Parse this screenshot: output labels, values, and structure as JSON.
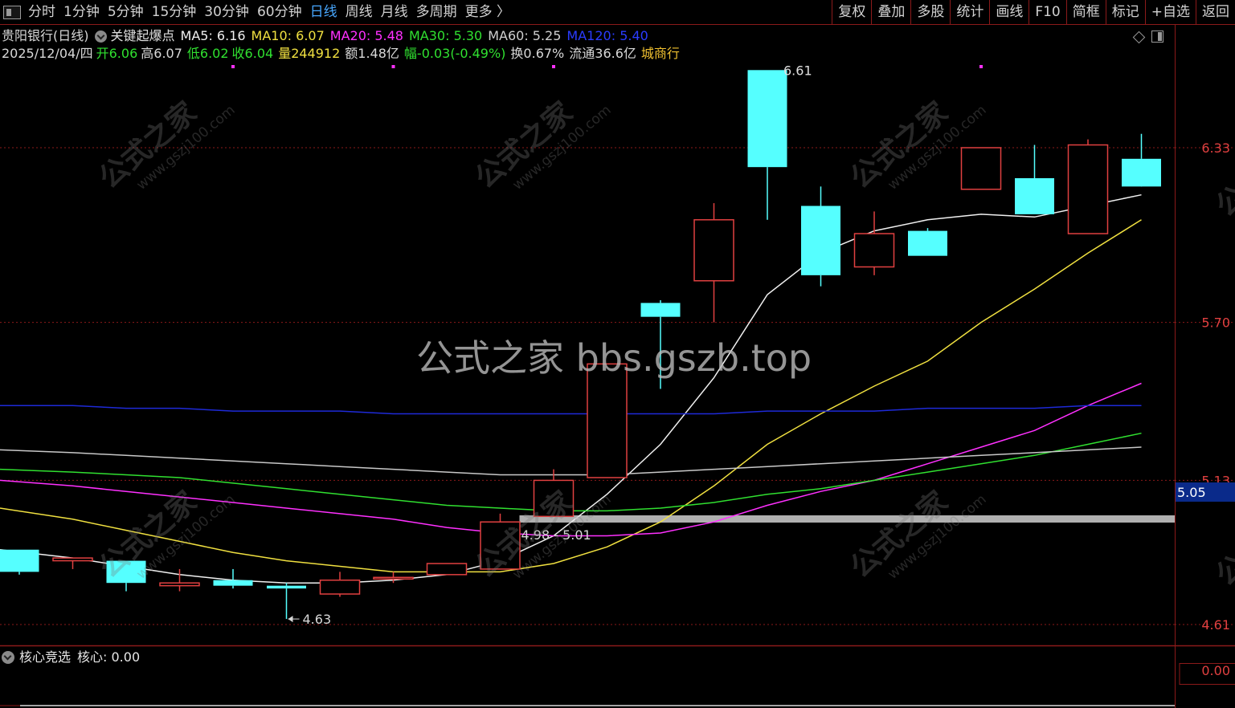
{
  "toolbar": {
    "period_tabs": [
      {
        "label": "分时",
        "active": false
      },
      {
        "label": "1分钟",
        "active": false
      },
      {
        "label": "5分钟",
        "active": false
      },
      {
        "label": "15分钟",
        "active": false
      },
      {
        "label": "30分钟",
        "active": false
      },
      {
        "label": "60分钟",
        "active": false
      },
      {
        "label": "日线",
        "active": true
      },
      {
        "label": "周线",
        "active": false
      },
      {
        "label": "月线",
        "active": false
      },
      {
        "label": "多周期",
        "active": false
      },
      {
        "label": "更多 〉",
        "active": false
      }
    ],
    "tools": [
      "复权",
      "叠加",
      "多股",
      "统计",
      "画线",
      "F10",
      "简框",
      "标记",
      "+自选",
      "返回"
    ]
  },
  "info": {
    "stock_name": "贵阳银行(日线)",
    "formula_name": "关键起爆点",
    "ma5": "MA5: 6.16",
    "ma10": "MA10: 6.07",
    "ma20": "MA20: 5.48",
    "ma30": "MA30: 5.30",
    "ma60": "MA60: 5.25",
    "ma120": "MA120: 5.40",
    "date": "2025/12/04/四",
    "open": "开6.06",
    "high": "高6.07",
    "low": "低6.02",
    "close": "收6.04",
    "volume": "量244912",
    "amount": "额1.48亿",
    "change": "幅-0.03(-0.49%)",
    "turnover": "换0.67%",
    "float_cap": "流通36.6亿",
    "industry": "城商行"
  },
  "indicator": {
    "name": "核心竞选",
    "value": "核心: 0.00",
    "axis_label": "0.00"
  },
  "watermark": {
    "center": "公式之家 bbs.gszb.top",
    "tile_cn": "公式之家",
    "tile_url": "www.gszj100.com"
  },
  "colors": {
    "up": "#e04040",
    "down": "#55ffff",
    "ma5": "#f0f0f0",
    "ma10": "#f0e040",
    "ma20": "#ff30ff",
    "ma30": "#30e030",
    "ma60": "#c8c8c8",
    "ma120": "#1e2ad8",
    "grid": "#8b1a1a",
    "zone": "#b0b0b0"
  },
  "chart_data": {
    "type": "candlestick",
    "y_ticks": [
      "6.33",
      "5.70",
      "5.13",
      "4.61"
    ],
    "y_range": [
      4.5,
      6.8
    ],
    "price_tag": "5.05",
    "zone_label": "4.98 - 5.01",
    "zone_range": [
      4.98,
      5.01
    ],
    "low_label": "4.63",
    "high_label": "6.61",
    "candles": [
      {
        "o": 4.88,
        "h": 4.88,
        "l": 4.79,
        "c": 4.8
      },
      {
        "o": 4.84,
        "h": 4.85,
        "l": 4.81,
        "c": 4.85
      },
      {
        "o": 4.84,
        "h": 4.84,
        "l": 4.73,
        "c": 4.76
      },
      {
        "o": 4.75,
        "h": 4.81,
        "l": 4.73,
        "c": 4.76
      },
      {
        "o": 4.77,
        "h": 4.81,
        "l": 4.74,
        "c": 4.75
      },
      {
        "o": 4.75,
        "h": 4.76,
        "l": 4.63,
        "c": 4.74
      },
      {
        "o": 4.72,
        "h": 4.8,
        "l": 4.71,
        "c": 4.77
      },
      {
        "o": 4.78,
        "h": 4.8,
        "l": 4.76,
        "c": 4.78
      },
      {
        "o": 4.79,
        "h": 4.82,
        "l": 4.79,
        "c": 4.83
      },
      {
        "o": 4.81,
        "h": 5.01,
        "l": 4.81,
        "c": 4.98
      },
      {
        "o": 5.0,
        "h": 5.17,
        "l": 5.0,
        "c": 5.13
      },
      {
        "o": 5.14,
        "h": 5.55,
        "l": 5.14,
        "c": 5.55
      },
      {
        "o": 5.77,
        "h": 5.78,
        "l": 5.46,
        "c": 5.72
      },
      {
        "o": 5.85,
        "h": 6.13,
        "l": 5.7,
        "c": 6.07
      },
      {
        "o": 6.61,
        "h": 6.61,
        "l": 6.07,
        "c": 6.26
      },
      {
        "o": 6.12,
        "h": 6.19,
        "l": 5.83,
        "c": 5.87
      },
      {
        "o": 5.9,
        "h": 6.1,
        "l": 5.87,
        "c": 6.02
      },
      {
        "o": 6.03,
        "h": 6.04,
        "l": 5.94,
        "c": 5.94
      },
      {
        "o": 6.18,
        "h": 6.33,
        "l": 6.18,
        "c": 6.33
      },
      {
        "o": 6.22,
        "h": 6.34,
        "l": 6.09,
        "c": 6.09
      },
      {
        "o": 6.02,
        "h": 6.36,
        "l": 6.02,
        "c": 6.34
      },
      {
        "o": 6.29,
        "h": 6.38,
        "l": 6.21,
        "c": 6.19
      }
    ],
    "series": [
      {
        "name": "MA5",
        "values": [
          4.88,
          4.85,
          4.82,
          4.79,
          4.77,
          4.76,
          4.76,
          4.77,
          4.79,
          4.84,
          4.93,
          5.08,
          5.26,
          5.5,
          5.8,
          5.95,
          6.03,
          6.07,
          6.09,
          6.08,
          6.12,
          6.16
        ]
      },
      {
        "name": "MA10",
        "values": [
          5.03,
          4.99,
          4.95,
          4.91,
          4.87,
          4.84,
          4.82,
          4.8,
          4.8,
          4.8,
          4.83,
          4.89,
          4.98,
          5.11,
          5.26,
          5.37,
          5.47,
          5.56,
          5.7,
          5.82,
          5.95,
          6.07
        ]
      },
      {
        "name": "MA20",
        "values": [
          5.13,
          5.11,
          5.09,
          5.07,
          5.05,
          5.03,
          5.01,
          4.99,
          4.96,
          4.94,
          4.93,
          4.93,
          4.94,
          4.98,
          5.04,
          5.09,
          5.13,
          5.19,
          5.25,
          5.31,
          5.4,
          5.48
        ]
      },
      {
        "name": "MA30",
        "values": [
          5.17,
          5.16,
          5.15,
          5.14,
          5.12,
          5.1,
          5.08,
          5.06,
          5.04,
          5.03,
          5.02,
          5.02,
          5.03,
          5.05,
          5.08,
          5.1,
          5.13,
          5.16,
          5.19,
          5.22,
          5.26,
          5.3
        ]
      },
      {
        "name": "MA60",
        "values": [
          5.24,
          5.23,
          5.22,
          5.21,
          5.2,
          5.19,
          5.18,
          5.17,
          5.16,
          5.15,
          5.15,
          5.15,
          5.16,
          5.17,
          5.18,
          5.19,
          5.2,
          5.21,
          5.22,
          5.23,
          5.24,
          5.25
        ]
      },
      {
        "name": "MA120",
        "values": [
          5.4,
          5.4,
          5.39,
          5.39,
          5.38,
          5.38,
          5.38,
          5.37,
          5.37,
          5.37,
          5.37,
          5.37,
          5.37,
          5.37,
          5.38,
          5.38,
          5.38,
          5.39,
          5.39,
          5.39,
          5.4,
          5.4
        ]
      }
    ],
    "signal_marker_indices": [
      4,
      7,
      10,
      18
    ]
  }
}
